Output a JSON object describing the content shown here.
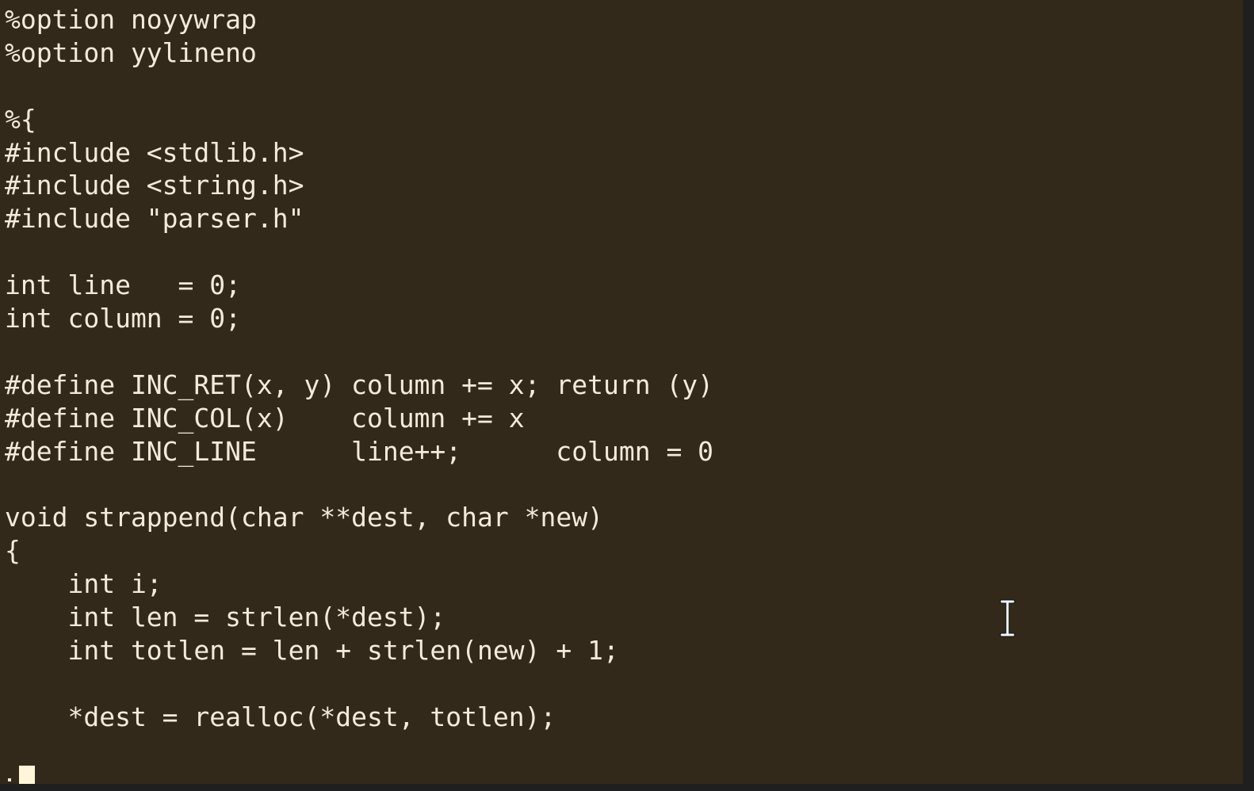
{
  "editor": {
    "lines": [
      "%option noyywrap",
      "%option yylineno",
      "",
      "%{",
      "#include <stdlib.h>",
      "#include <string.h>",
      "#include \"parser.h\"",
      "",
      "int line   = 0;",
      "int column = 0;",
      "",
      "#define INC_RET(x, y) column += x; return (y)",
      "#define INC_COL(x)    column += x",
      "#define INC_LINE      line++;      column = 0",
      "",
      "void strappend(char **dest, char *new)",
      "{",
      "    int i;",
      "    int len = strlen(*dest);",
      "    int totlen = len + strlen(new) + 1;",
      "",
      "    *dest = realloc(*dest, totlen);",
      ""
    ]
  },
  "pointer": {
    "icon": "text-ibeam-cursor-icon"
  },
  "colors": {
    "background": "#33291a",
    "text": "#f3eadb",
    "cursor": "#fff6d8"
  }
}
